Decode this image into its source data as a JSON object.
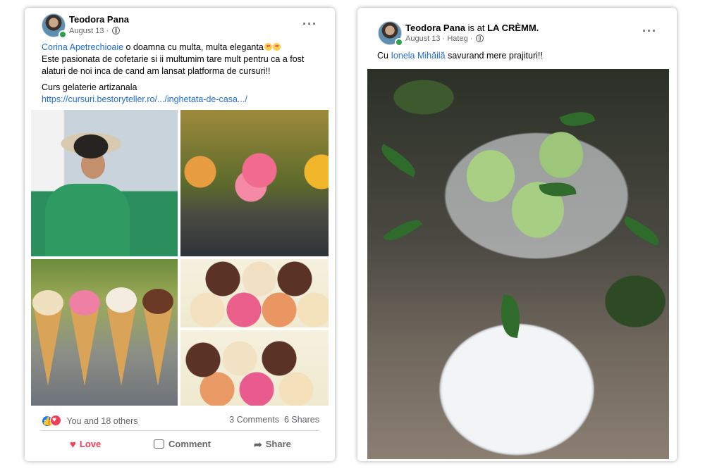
{
  "post1": {
    "author": "Teodora Pana",
    "date": "August 13",
    "more": "···",
    "mention": "Corina Apetrechioaie",
    "line1_rest": " o doamna cu multa, multa eleganta",
    "line2": "Este pasionata de cofetarie si ii multumim tare mult pentru ca a fost alaturi de noi inca de cand am lansat platforma de cursuri!!",
    "line3": "Curs gelaterie artizanala",
    "link": "https://cursuri.bestoryteller.ro/.../inghetata-de-casa.../",
    "reactions_text": "You and 18 others",
    "comments": "3 Comments",
    "shares": "6 Shares",
    "actions": {
      "love": "Love",
      "comment": "Comment",
      "share": "Share"
    }
  },
  "post2": {
    "author": "Teodora Pana",
    "is_at": "is at",
    "place": "LA CRÈMM.",
    "date": "August 13",
    "location": "Hateg",
    "more": "···",
    "text_prefix": "Cu ",
    "mention": "Ionela Mihăilă",
    "text_rest": " savurand mere prajituri!!"
  },
  "icons": {
    "globe": "globe-icon",
    "like": "like-reaction-icon",
    "love": "love-reaction-icon",
    "comment": "comment-icon",
    "share": "share-icon"
  },
  "colors": {
    "link": "#216fdb",
    "love": "#f33e58",
    "online": "#31a24c"
  }
}
